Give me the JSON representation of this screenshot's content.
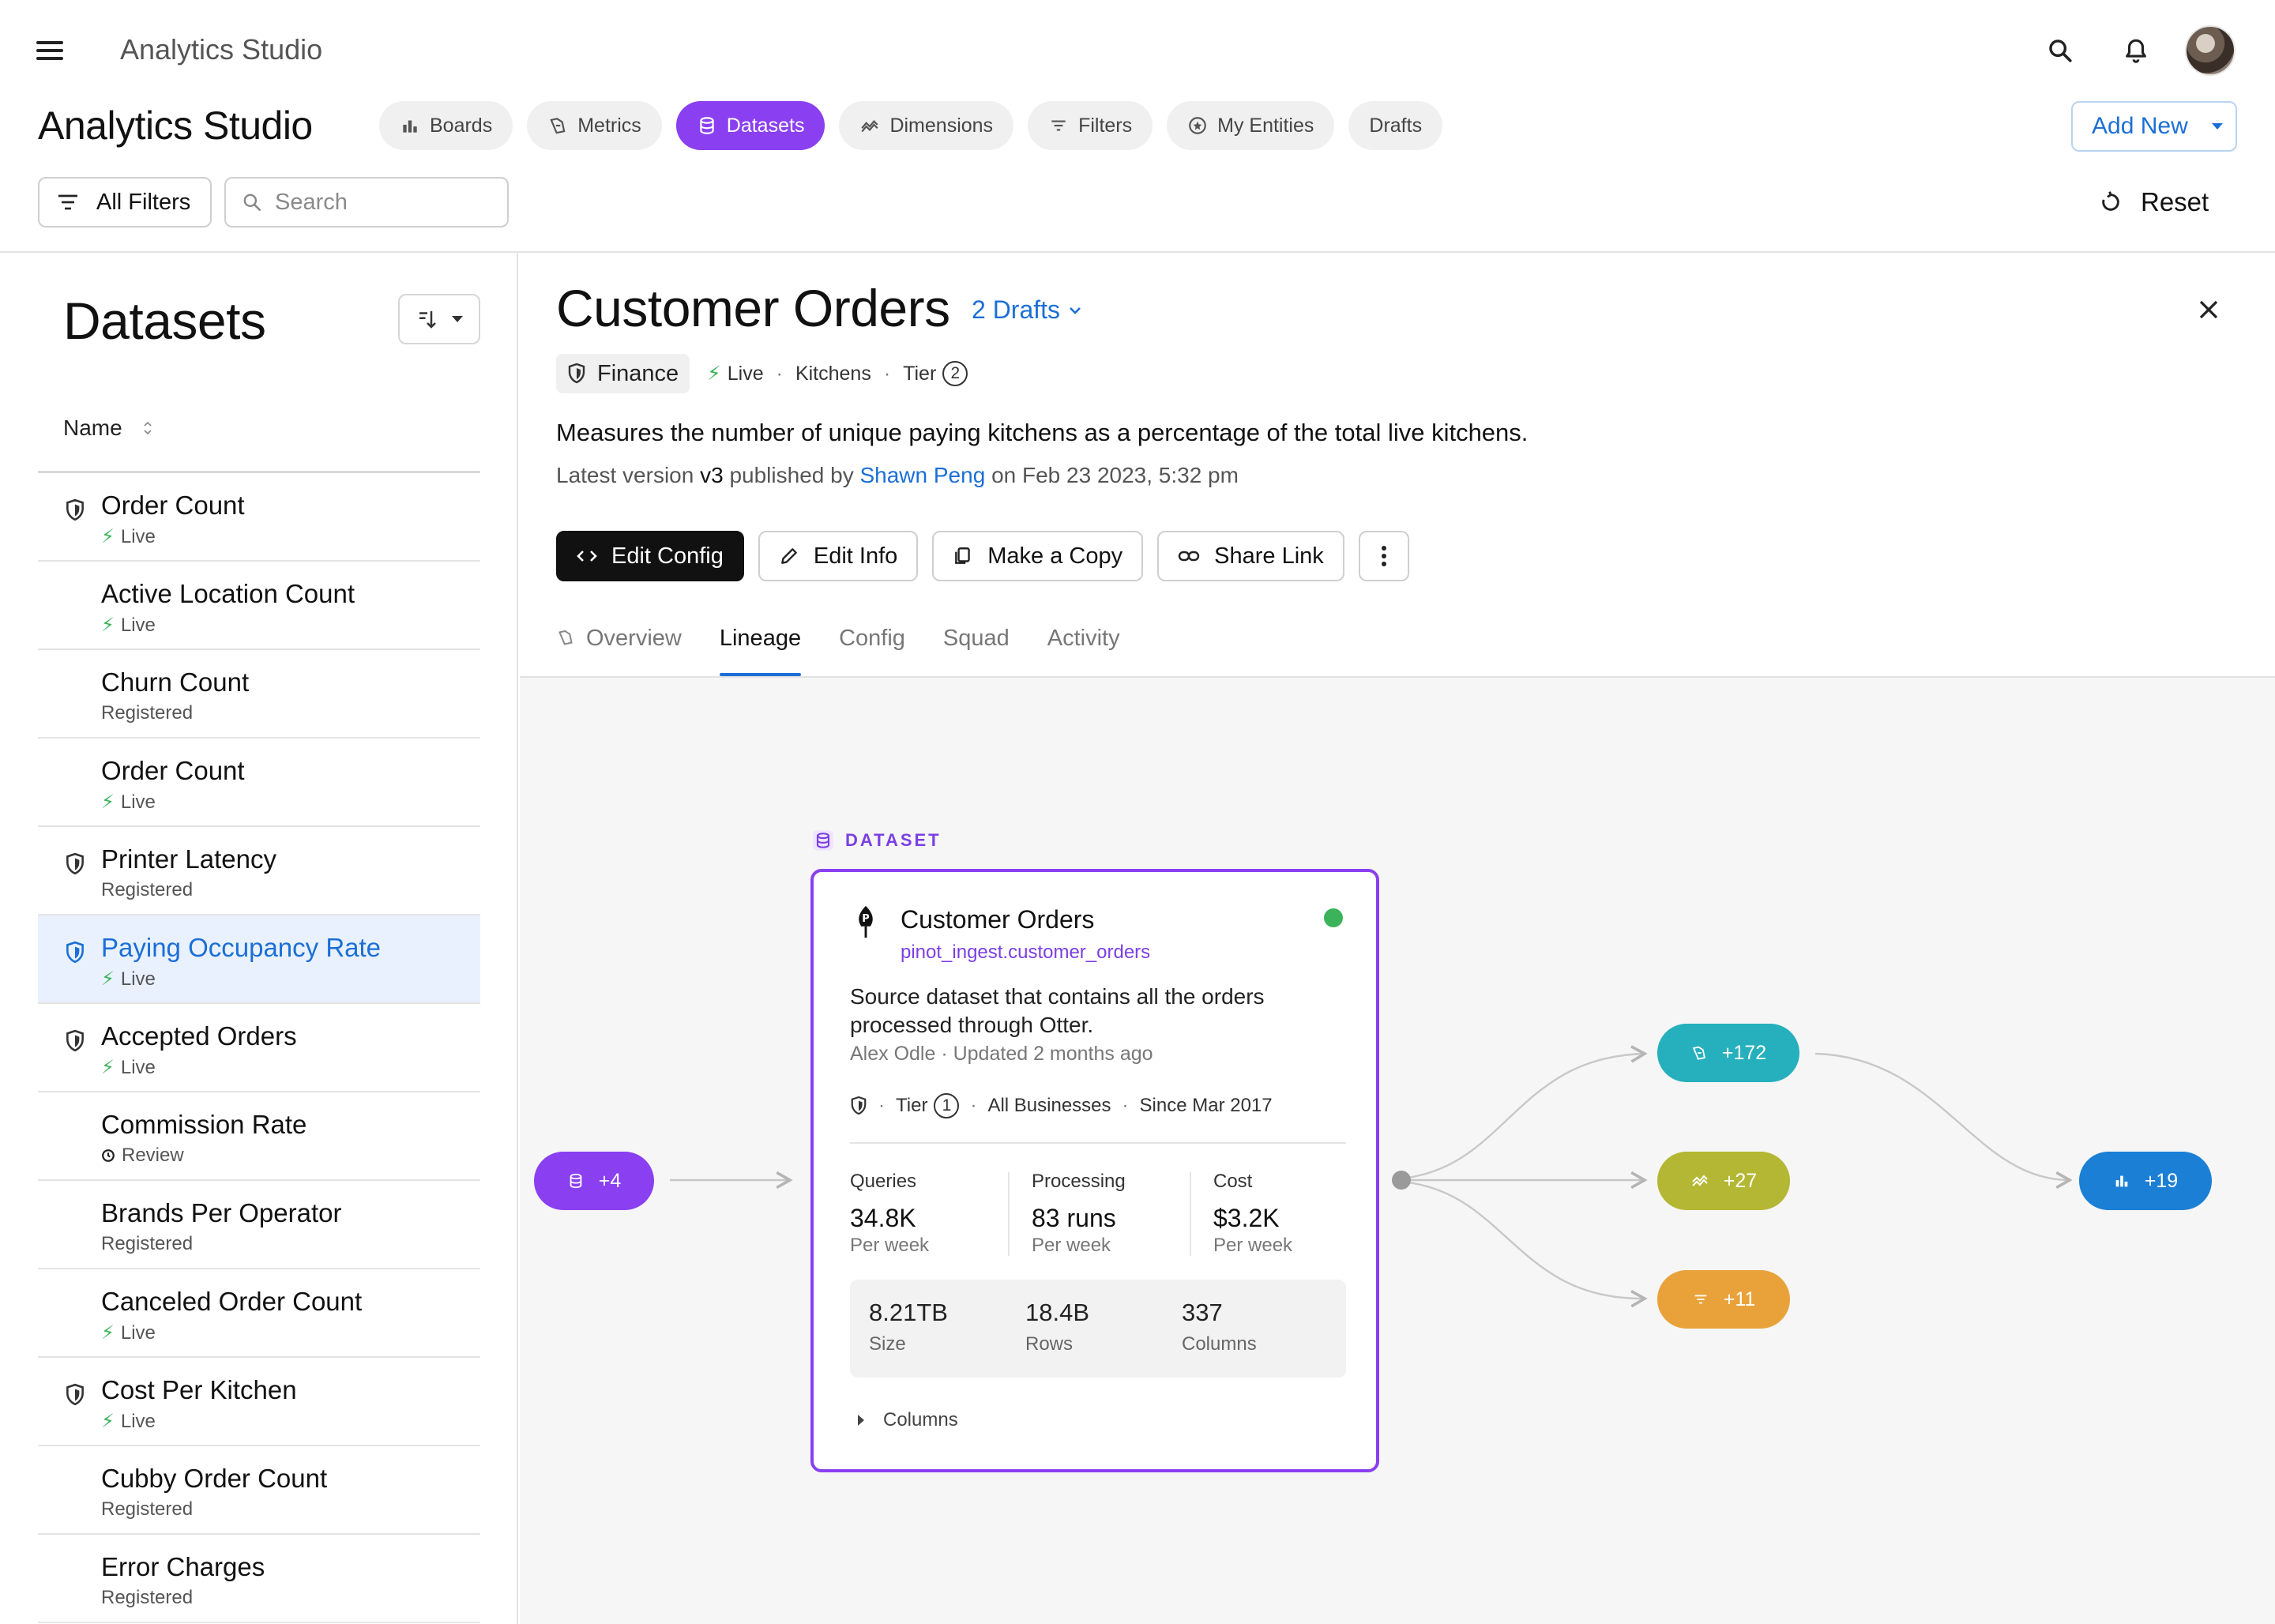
{
  "app": {
    "name": "Analytics Studio",
    "page_title": "Analytics Studio"
  },
  "nav": {
    "chips": [
      {
        "label": "Boards",
        "icon": "bar-chart-icon",
        "active": false
      },
      {
        "label": "Metrics",
        "icon": "metric-icon",
        "active": false
      },
      {
        "label": "Datasets",
        "icon": "database-icon",
        "active": true
      },
      {
        "label": "Dimensions",
        "icon": "dimension-icon",
        "active": false
      },
      {
        "label": "Filters",
        "icon": "filter-icon",
        "active": false
      },
      {
        "label": "My Entities",
        "icon": "star-circle-icon",
        "active": false
      },
      {
        "label": "Drafts",
        "icon": "",
        "active": false
      }
    ],
    "add_new_label": "Add New"
  },
  "toolbar": {
    "all_filters_label": "All Filters",
    "search_placeholder": "Search",
    "reset_label": "Reset"
  },
  "sidebar": {
    "title": "Datasets",
    "column_header": "Name",
    "items": [
      {
        "name": "Order Count",
        "status": "Live",
        "status_icon": "bolt-icon",
        "shield": true,
        "selected": false
      },
      {
        "name": "Active Location Count",
        "status": "Live",
        "status_icon": "bolt-icon",
        "shield": false,
        "selected": false
      },
      {
        "name": "Churn Count",
        "status": "Registered",
        "status_icon": "",
        "shield": false,
        "selected": false
      },
      {
        "name": "Order Count",
        "status": "Live",
        "status_icon": "bolt-icon",
        "shield": false,
        "selected": false
      },
      {
        "name": "Printer Latency",
        "status": "Registered",
        "status_icon": "",
        "shield": true,
        "selected": false
      },
      {
        "name": "Paying Occupancy Rate",
        "status": "Live",
        "status_icon": "bolt-icon",
        "shield": true,
        "selected": true
      },
      {
        "name": "Accepted Orders",
        "status": "Live",
        "status_icon": "bolt-icon",
        "shield": true,
        "selected": false
      },
      {
        "name": "Commission Rate",
        "status": "Review",
        "status_icon": "review-icon",
        "shield": false,
        "selected": false
      },
      {
        "name": "Brands Per Operator",
        "status": "Registered",
        "status_icon": "",
        "shield": false,
        "selected": false
      },
      {
        "name": "Canceled Order Count",
        "status": "Live",
        "status_icon": "bolt-icon",
        "shield": false,
        "selected": false
      },
      {
        "name": "Cost Per Kitchen",
        "status": "Live",
        "status_icon": "bolt-icon",
        "shield": true,
        "selected": false
      },
      {
        "name": "Cubby Order Count",
        "status": "Registered",
        "status_icon": "",
        "shield": false,
        "selected": false
      },
      {
        "name": "Error Charges",
        "status": "Registered",
        "status_icon": "",
        "shield": false,
        "selected": false
      }
    ]
  },
  "detail": {
    "title": "Customer Orders",
    "drafts_label": "2 Drafts",
    "meta": {
      "team": "Finance",
      "status": "Live",
      "domain": "Kitchens",
      "tier_label": "Tier",
      "tier_value": "2"
    },
    "description": "Measures the number of unique paying kitchens as a percentage of the total live kitchens.",
    "latest": {
      "prefix": "Latest version",
      "version": "v3",
      "published_by": "published by",
      "author": "Shawn Peng",
      "date": "on Feb 23 2023, 5:32 pm"
    },
    "actions": {
      "edit_config": "Edit Config",
      "edit_info": "Edit Info",
      "make_copy": "Make a Copy",
      "share_link": "Share Link"
    },
    "tabs": [
      {
        "label": "Overview",
        "active": false
      },
      {
        "label": "Lineage",
        "active": true
      },
      {
        "label": "Config",
        "active": false
      },
      {
        "label": "Squad",
        "active": false
      },
      {
        "label": "Activity",
        "active": false
      }
    ]
  },
  "lineage": {
    "upstream_count": "+4",
    "node_type_label": "DATASET",
    "card": {
      "title": "Customer Orders",
      "source": "pinot_ingest.customer_orders",
      "description": "Source dataset that contains all the orders processed through Otter.",
      "author_line": "Alex Odle · Updated 2 months ago",
      "tier_label": "Tier",
      "tier_value": "1",
      "scope": "All Businesses",
      "since": "Since Mar 2017",
      "stats": [
        {
          "label": "Queries",
          "value": "34.8K",
          "unit": "Per week"
        },
        {
          "label": "Processing",
          "value": "83 runs",
          "unit": "Per week"
        },
        {
          "label": "Cost",
          "value": "$3.2K",
          "unit": "Per week"
        }
      ],
      "sizes": [
        {
          "value": "8.21TB",
          "label": "Size"
        },
        {
          "value": "18.4B",
          "label": "Rows"
        },
        {
          "value": "337",
          "label": "Columns"
        }
      ],
      "columns_toggle": "Columns"
    },
    "downstream": {
      "metrics": "+172",
      "dimensions": "+27",
      "filters": "+11",
      "boards": "+19"
    },
    "colors": {
      "accent_purple": "#8a3ff0",
      "metrics_teal": "#26b0bd",
      "dimensions_olive": "#b3b733",
      "filters_orange": "#e9a23a",
      "boards_blue": "#1b7fd6",
      "status_green": "#3cb35b"
    }
  }
}
